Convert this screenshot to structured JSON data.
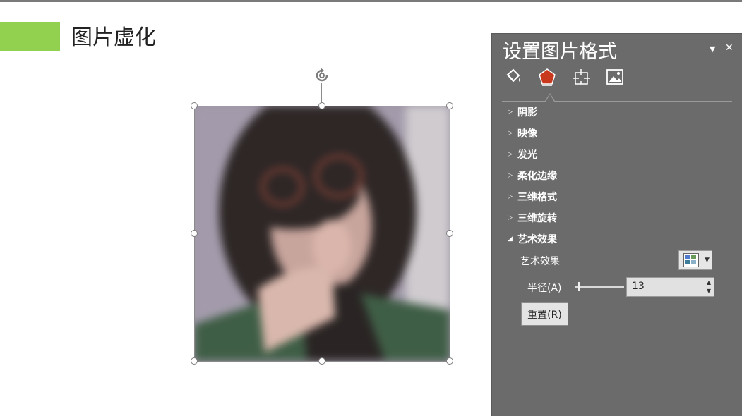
{
  "slide": {
    "title": "图片虚化",
    "accent_color": "#92d050"
  },
  "pane": {
    "title": "设置图片格式",
    "dropdown_icon": "triangle-down-icon",
    "close_label": "✕",
    "tabs": [
      {
        "icon": "fill-line-icon"
      },
      {
        "icon": "effects-pentagon-icon",
        "active": true
      },
      {
        "icon": "size-properties-icon"
      },
      {
        "icon": "picture-icon"
      }
    ],
    "sections": [
      {
        "label": "阴影",
        "expanded": false
      },
      {
        "label": "映像",
        "expanded": false
      },
      {
        "label": "发光",
        "expanded": false
      },
      {
        "label": "柔化边缘",
        "expanded": false
      },
      {
        "label": "三维格式",
        "expanded": false
      },
      {
        "label": "三维旋转",
        "expanded": false
      },
      {
        "label": "艺术效果",
        "expanded": true
      }
    ],
    "art_effect": {
      "label": "艺术效果",
      "radius_label": "半径(A)",
      "radius_value": "13",
      "reset_label": "重置(R)"
    }
  }
}
